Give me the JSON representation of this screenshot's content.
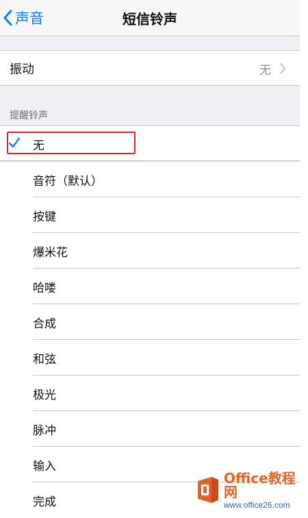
{
  "navbar": {
    "back_label": "声音",
    "title": "短信铃声"
  },
  "vibration": {
    "label": "振动",
    "value": "无"
  },
  "section": {
    "header": "提醒铃声"
  },
  "tones": [
    {
      "label": "无",
      "selected": true
    },
    {
      "label": "音符（默认）",
      "selected": false
    },
    {
      "label": "按键",
      "selected": false
    },
    {
      "label": "爆米花",
      "selected": false
    },
    {
      "label": "哈喽",
      "selected": false
    },
    {
      "label": "合成",
      "selected": false
    },
    {
      "label": "和弦",
      "selected": false
    },
    {
      "label": "极光",
      "selected": false
    },
    {
      "label": "脉冲",
      "selected": false
    },
    {
      "label": "输入",
      "selected": false
    },
    {
      "label": "完成",
      "selected": false
    }
  ],
  "colors": {
    "accent": "#0a7aff",
    "highlight_box": "#e0241b",
    "secondary_text": "#8e8e93",
    "group_background": "#efeff4"
  },
  "icons": {
    "back": "chevron-left-icon",
    "disclosure": "chevron-right-icon",
    "checkmark": "checkmark-icon"
  },
  "watermark": {
    "title": "Office教程网",
    "url": "www.office26.com"
  }
}
